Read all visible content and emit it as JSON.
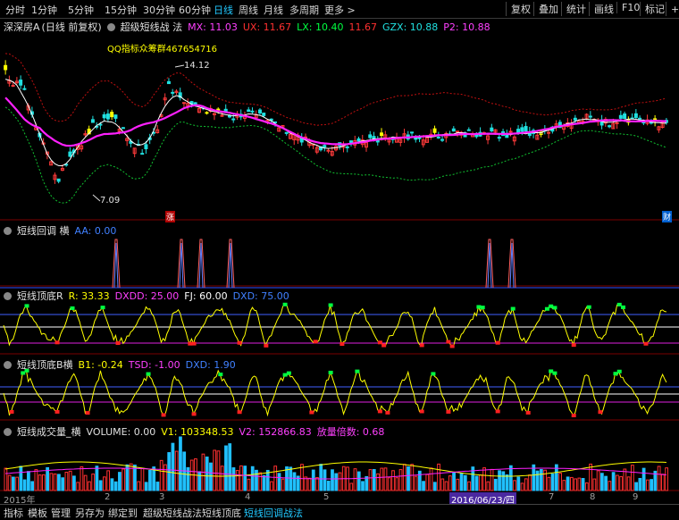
{
  "periods": [
    "分时",
    "1分钟",
    "5分钟",
    "15分钟",
    "30分钟",
    "60分钟",
    "日线",
    "周线",
    "月线",
    "多周期",
    "更多 >"
  ],
  "active_period": "日线",
  "right_buttons": [
    "复权",
    "叠加",
    "统计",
    "画线",
    "F10",
    "标记",
    "+自"
  ],
  "main": {
    "stock_name": "深深房A",
    "mode": "(日线 前复权)",
    "indicator": "超级短线战 法",
    "mx": "MX: 11.03",
    "ux": "UX: 11.67",
    "lx": "LX: 10.40",
    "v2": "11.67",
    "gzx": "GZX: 10.88",
    "p2": "P2: 10.88",
    "watermark": "QQ指标众筹群467654716",
    "high_label": "14.12",
    "low_label": "7.09",
    "flag_up": "涨",
    "flag_fin": "财"
  },
  "panel2": {
    "title": "短线回调 横",
    "aa": "AA: 0.00"
  },
  "panel3": {
    "title": "短线顶底R",
    "r": "R: 33.33",
    "dxdd": "DXDD: 25.00",
    "fj": "FJ: 60.00",
    "dxd": "DXD: 75.00"
  },
  "panel4": {
    "title": "短线顶底B横",
    "b1": "B1: -0.24",
    "tsd": "TSD: -1.00",
    "dxd": "DXD: 1.90"
  },
  "panel5": {
    "title": "短线成交量_横",
    "volume": "VOLUME: 0.00",
    "v1": "V1: 103348.53",
    "v2": "V2: 152866.83",
    "ratio": "放量倍数: 0.68"
  },
  "xaxis": {
    "year": "2015年",
    "m2": "2",
    "m3": "3",
    "m4": "4",
    "m5": "5",
    "m7": "7",
    "m8": "8",
    "m9": "9",
    "cursor_date": "2016/06/23/四"
  },
  "bottom_tabs": [
    "指标",
    "模板",
    "管理",
    "另存为",
    "绑定到",
    "超级短线战法",
    "短线顶底",
    "短线回调战法"
  ],
  "active_bottom_tab": "短线回调战法",
  "colors": {
    "up": "#ff3a3a",
    "down": "#20e0e0",
    "ma": "#ff20ff",
    "white": "#ffffff",
    "yellow": "#ffff00",
    "green": "#00ff40",
    "bg": "#000000"
  }
}
